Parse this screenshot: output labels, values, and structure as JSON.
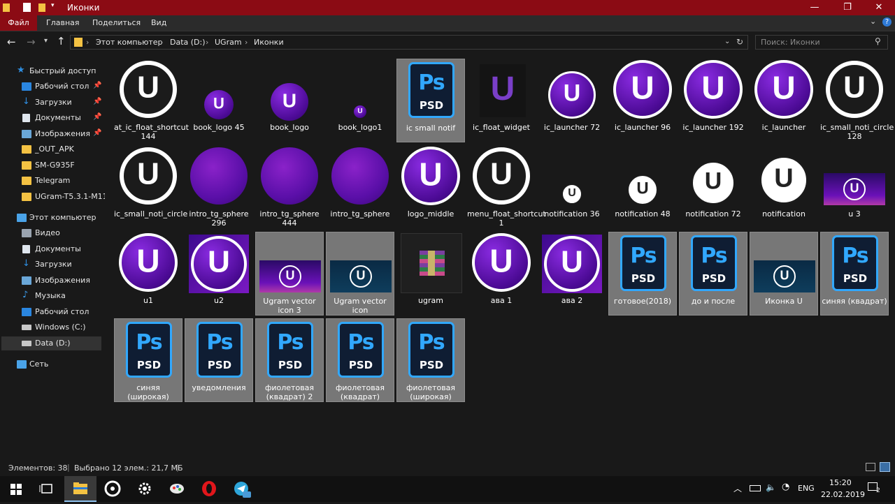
{
  "window": {
    "title": "Иконки"
  },
  "ribbon": {
    "file": "Файл",
    "tabs": [
      "Главная",
      "Поделиться",
      "Вид"
    ]
  },
  "address": {
    "crumbs": [
      "Этот компьютер",
      "Data (D:)",
      "UGram",
      "Иконки"
    ],
    "search_placeholder": "Поиск: Иконки"
  },
  "nav": {
    "quick_access": "Быстрый доступ",
    "items": [
      "Рабочий стол",
      "Загрузки",
      "Документы",
      "Изображения",
      "_OUT_APK",
      "SM-G935F",
      "Telegram",
      "UGram-T5.3.1-M11."
    ],
    "this_pc": "Этот компьютер",
    "pc_items": [
      "Видео",
      "Документы",
      "Загрузки",
      "Изображения",
      "Музыка",
      "Рабочий стол",
      "Windows (C:)",
      "Data (D:)"
    ],
    "network": "Сеть"
  },
  "files": [
    {
      "name": "at_ic_float_shortcut 144",
      "kind": "ring-white"
    },
    {
      "name": "book_logo 45",
      "kind": "purple-small"
    },
    {
      "name": "book_logo",
      "kind": "purple-mid"
    },
    {
      "name": "book_logo1",
      "kind": "purple-tiny"
    },
    {
      "name": "ic small notif",
      "kind": "psd",
      "selected": true
    },
    {
      "name": "ic_float_widget",
      "kind": "outline-u"
    },
    {
      "name": "ic_launcher 72",
      "kind": "purple-ring-m"
    },
    {
      "name": "ic_launcher 96",
      "kind": "purple-ring-l"
    },
    {
      "name": "ic_launcher 192",
      "kind": "purple-ring-l"
    },
    {
      "name": "ic_launcher",
      "kind": "purple-ring-l"
    },
    {
      "name": "ic_small_noti_circle 128",
      "kind": "ring-white"
    },
    {
      "name": "ic_small_noti_circle",
      "kind": "ring-white"
    },
    {
      "name": "intro_tg_sphere 296",
      "kind": "sphere"
    },
    {
      "name": "intro_tg_sphere 444",
      "kind": "sphere"
    },
    {
      "name": "intro_tg_sphere",
      "kind": "sphere"
    },
    {
      "name": "logo_middle",
      "kind": "purple-ring-l"
    },
    {
      "name": "menu_float_shortcut 1",
      "kind": "ring-white"
    },
    {
      "name": "notification 36",
      "kind": "white-small"
    },
    {
      "name": "notification 48",
      "kind": "white-mid"
    },
    {
      "name": "notification 72",
      "kind": "white-large"
    },
    {
      "name": "notification",
      "kind": "white-xl"
    },
    {
      "name": "u 3",
      "kind": "banner-purple"
    },
    {
      "name": "u1",
      "kind": "purple-ring-l"
    },
    {
      "name": "u2",
      "kind": "purple-square"
    },
    {
      "name": "Ugram vector icon 3",
      "kind": "banner-purple",
      "selected": true
    },
    {
      "name": "Ugram vector icon",
      "kind": "banner-teal",
      "selected": true
    },
    {
      "name": "ugram",
      "kind": "archive"
    },
    {
      "name": "ава 1",
      "kind": "purple-ring-l"
    },
    {
      "name": "ава 2",
      "kind": "purple-square"
    },
    {
      "name": "готовое(2018)",
      "kind": "psd",
      "selected": true
    },
    {
      "name": "до и после",
      "kind": "psd",
      "selected": true
    },
    {
      "name": "Иконка U",
      "kind": "banner-teal",
      "selected": true
    },
    {
      "name": "синяя (квадрат)",
      "kind": "psd",
      "selected": true
    },
    {
      "name": "синяя (широкая)",
      "kind": "psd",
      "selected": true
    },
    {
      "name": "уведомления",
      "kind": "psd",
      "selected": true
    },
    {
      "name": "фиолетовая (квадрат) 2",
      "kind": "psd",
      "selected": true
    },
    {
      "name": "фиолетовая (квадрат)",
      "kind": "psd",
      "selected": true
    },
    {
      "name": "фиолетовая (широкая)",
      "kind": "psd",
      "selected": true
    }
  ],
  "status": {
    "count": "Элементов: 38",
    "selected": "Выбрано 12 элем.: 21,7 МБ"
  },
  "taskbar": {
    "lang": "ENG",
    "time": "15:20",
    "date": "22.02.2019",
    "notif_count": "2"
  },
  "colors": {
    "titlebar": "#8b0b14",
    "psd_blue": "#31a8ff",
    "purple": "#6a11b8"
  }
}
